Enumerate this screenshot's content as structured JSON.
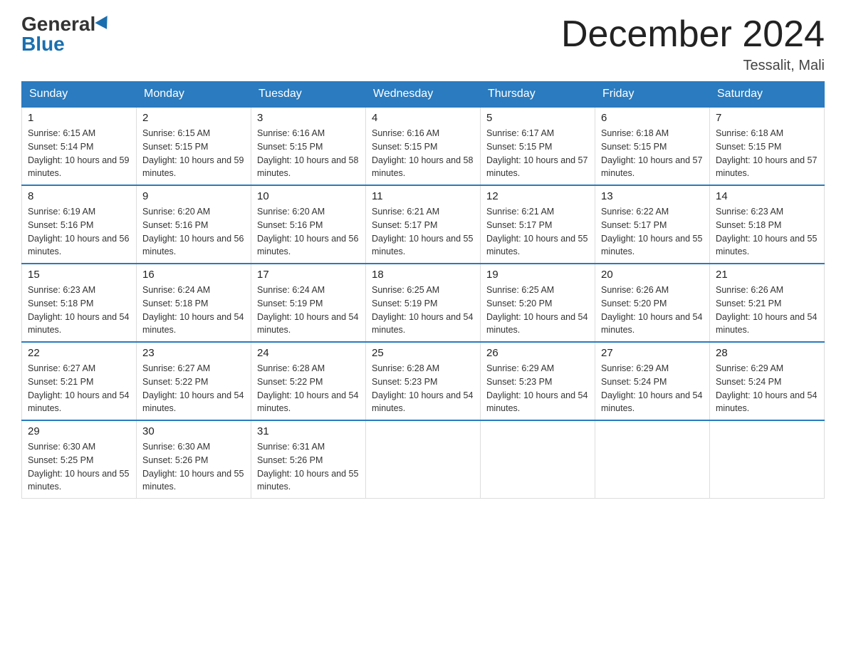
{
  "logo": {
    "general": "General",
    "blue": "Blue"
  },
  "header": {
    "title": "December 2024",
    "location": "Tessalit, Mali"
  },
  "days_of_week": [
    "Sunday",
    "Monday",
    "Tuesday",
    "Wednesday",
    "Thursday",
    "Friday",
    "Saturday"
  ],
  "weeks": [
    [
      {
        "day": "1",
        "sunrise": "6:15 AM",
        "sunset": "5:14 PM",
        "daylight": "10 hours and 59 minutes."
      },
      {
        "day": "2",
        "sunrise": "6:15 AM",
        "sunset": "5:15 PM",
        "daylight": "10 hours and 59 minutes."
      },
      {
        "day": "3",
        "sunrise": "6:16 AM",
        "sunset": "5:15 PM",
        "daylight": "10 hours and 58 minutes."
      },
      {
        "day": "4",
        "sunrise": "6:16 AM",
        "sunset": "5:15 PM",
        "daylight": "10 hours and 58 minutes."
      },
      {
        "day": "5",
        "sunrise": "6:17 AM",
        "sunset": "5:15 PM",
        "daylight": "10 hours and 57 minutes."
      },
      {
        "day": "6",
        "sunrise": "6:18 AM",
        "sunset": "5:15 PM",
        "daylight": "10 hours and 57 minutes."
      },
      {
        "day": "7",
        "sunrise": "6:18 AM",
        "sunset": "5:15 PM",
        "daylight": "10 hours and 57 minutes."
      }
    ],
    [
      {
        "day": "8",
        "sunrise": "6:19 AM",
        "sunset": "5:16 PM",
        "daylight": "10 hours and 56 minutes."
      },
      {
        "day": "9",
        "sunrise": "6:20 AM",
        "sunset": "5:16 PM",
        "daylight": "10 hours and 56 minutes."
      },
      {
        "day": "10",
        "sunrise": "6:20 AM",
        "sunset": "5:16 PM",
        "daylight": "10 hours and 56 minutes."
      },
      {
        "day": "11",
        "sunrise": "6:21 AM",
        "sunset": "5:17 PM",
        "daylight": "10 hours and 55 minutes."
      },
      {
        "day": "12",
        "sunrise": "6:21 AM",
        "sunset": "5:17 PM",
        "daylight": "10 hours and 55 minutes."
      },
      {
        "day": "13",
        "sunrise": "6:22 AM",
        "sunset": "5:17 PM",
        "daylight": "10 hours and 55 minutes."
      },
      {
        "day": "14",
        "sunrise": "6:23 AM",
        "sunset": "5:18 PM",
        "daylight": "10 hours and 55 minutes."
      }
    ],
    [
      {
        "day": "15",
        "sunrise": "6:23 AM",
        "sunset": "5:18 PM",
        "daylight": "10 hours and 54 minutes."
      },
      {
        "day": "16",
        "sunrise": "6:24 AM",
        "sunset": "5:18 PM",
        "daylight": "10 hours and 54 minutes."
      },
      {
        "day": "17",
        "sunrise": "6:24 AM",
        "sunset": "5:19 PM",
        "daylight": "10 hours and 54 minutes."
      },
      {
        "day": "18",
        "sunrise": "6:25 AM",
        "sunset": "5:19 PM",
        "daylight": "10 hours and 54 minutes."
      },
      {
        "day": "19",
        "sunrise": "6:25 AM",
        "sunset": "5:20 PM",
        "daylight": "10 hours and 54 minutes."
      },
      {
        "day": "20",
        "sunrise": "6:26 AM",
        "sunset": "5:20 PM",
        "daylight": "10 hours and 54 minutes."
      },
      {
        "day": "21",
        "sunrise": "6:26 AM",
        "sunset": "5:21 PM",
        "daylight": "10 hours and 54 minutes."
      }
    ],
    [
      {
        "day": "22",
        "sunrise": "6:27 AM",
        "sunset": "5:21 PM",
        "daylight": "10 hours and 54 minutes."
      },
      {
        "day": "23",
        "sunrise": "6:27 AM",
        "sunset": "5:22 PM",
        "daylight": "10 hours and 54 minutes."
      },
      {
        "day": "24",
        "sunrise": "6:28 AM",
        "sunset": "5:22 PM",
        "daylight": "10 hours and 54 minutes."
      },
      {
        "day": "25",
        "sunrise": "6:28 AM",
        "sunset": "5:23 PM",
        "daylight": "10 hours and 54 minutes."
      },
      {
        "day": "26",
        "sunrise": "6:29 AM",
        "sunset": "5:23 PM",
        "daylight": "10 hours and 54 minutes."
      },
      {
        "day": "27",
        "sunrise": "6:29 AM",
        "sunset": "5:24 PM",
        "daylight": "10 hours and 54 minutes."
      },
      {
        "day": "28",
        "sunrise": "6:29 AM",
        "sunset": "5:24 PM",
        "daylight": "10 hours and 54 minutes."
      }
    ],
    [
      {
        "day": "29",
        "sunrise": "6:30 AM",
        "sunset": "5:25 PM",
        "daylight": "10 hours and 55 minutes."
      },
      {
        "day": "30",
        "sunrise": "6:30 AM",
        "sunset": "5:26 PM",
        "daylight": "10 hours and 55 minutes."
      },
      {
        "day": "31",
        "sunrise": "6:31 AM",
        "sunset": "5:26 PM",
        "daylight": "10 hours and 55 minutes."
      },
      null,
      null,
      null,
      null
    ]
  ]
}
